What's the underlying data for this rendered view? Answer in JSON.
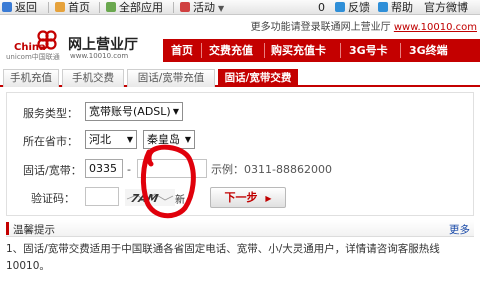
{
  "toolbar": {
    "back": "返回",
    "home": "首页",
    "all_apps": "全部应用",
    "activity": "活动",
    "count": "0",
    "feedback": "反馈",
    "help": "帮助",
    "weibo": "官方微博"
  },
  "header": {
    "notice_prefix": "更多功能请登录联通网上营业厅",
    "notice_link": "www.10010.com",
    "logo_cn": "China",
    "logo_en": "unicom中国联通",
    "site_title": "网上营业厅",
    "site_url": "www.10010.com"
  },
  "nav": [
    "首页",
    "交费充值",
    "购买充值卡",
    "3G号卡",
    "3G终端"
  ],
  "tabs": [
    {
      "label": "手机充值",
      "active": false
    },
    {
      "label": "手机交费",
      "active": false
    },
    {
      "label": "固话/宽带充值",
      "active": false
    },
    {
      "label": "固话/宽带交费",
      "active": true
    }
  ],
  "form": {
    "service_type_label": "服务类型：",
    "service_type_value": "宽带账号(ADSL)",
    "city_label": "所在省市：",
    "province_value": "河北",
    "city_value": "秦皇岛",
    "number_label": "固话/宽带：",
    "area_code_value": "0335",
    "dash": "-",
    "number_value": "",
    "example": "示例：0311-88862000",
    "captcha_label": "验证码：",
    "captcha_value": "",
    "captcha_text": "7AM",
    "refresh": "新",
    "next_button": "下一步"
  },
  "tips": {
    "title": "温馨提示",
    "more": "更多",
    "item1": "1、固话/宽带交费适用于中国联通各省固定电话、宽带、小/大灵通用户，详情请咨询客服热线10010。"
  },
  "colors": {
    "brand_red": "#c40000",
    "link_blue": "#1a4aa8",
    "scribble": "#e0000b"
  },
  "icons": [
    "back-icon",
    "home-icon",
    "grid-icon",
    "activity-icon",
    "chevron-down-icon",
    "feedback-icon",
    "help-icon",
    "weibo-icon",
    "unicom-knot-icon",
    "arrow-right-icon"
  ]
}
